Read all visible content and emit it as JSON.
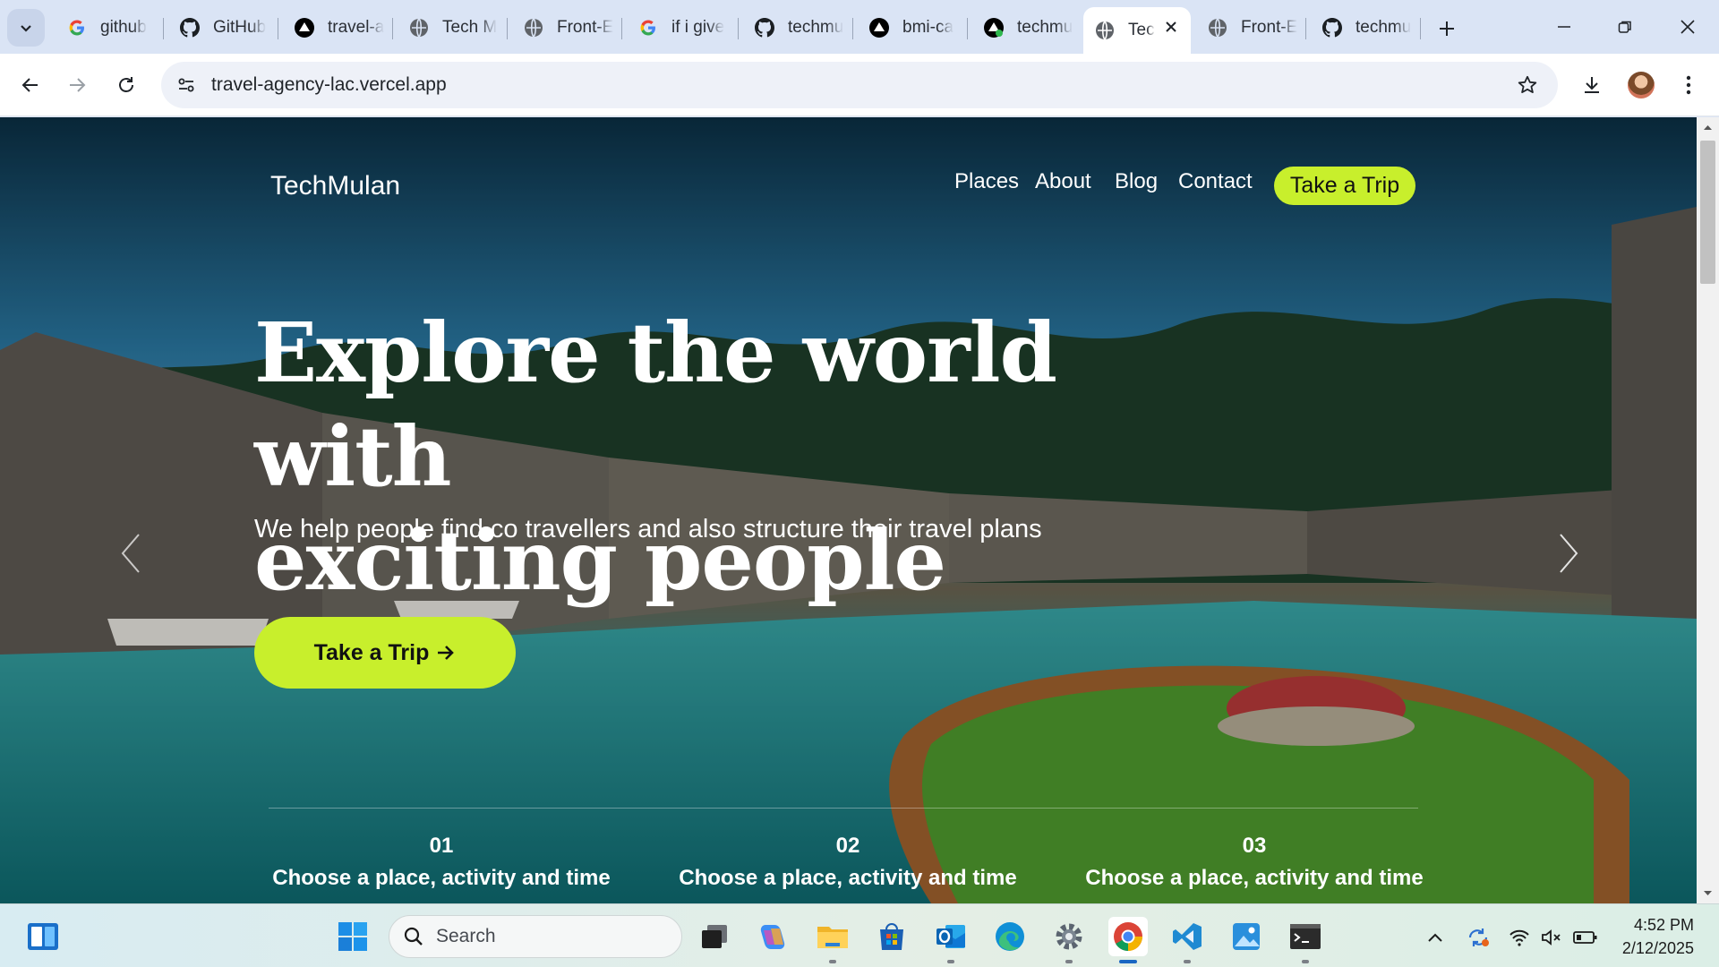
{
  "browser": {
    "tabs": [
      {
        "title": "github",
        "favicon": "google-icon"
      },
      {
        "title": "GitHub",
        "favicon": "github-icon"
      },
      {
        "title": "travel-a",
        "favicon": "vercel-icon"
      },
      {
        "title": "Tech M",
        "favicon": "globe-icon"
      },
      {
        "title": "Front-E",
        "favicon": "globe-icon"
      },
      {
        "title": "if i give",
        "favicon": "google-icon"
      },
      {
        "title": "techmu",
        "favicon": "github-icon"
      },
      {
        "title": "bmi-ca",
        "favicon": "vercel-icon"
      },
      {
        "title": "techmu",
        "favicon": "vercel-icon"
      },
      {
        "title": "Tec",
        "favicon": "globe-icon",
        "active": true
      },
      {
        "title": "Front-E",
        "favicon": "globe-icon"
      },
      {
        "title": "techmu",
        "favicon": "github-icon"
      }
    ],
    "url": "travel-agency-lac.vercel.app"
  },
  "site": {
    "brand": "TechMulan",
    "nav": [
      "Places",
      "About",
      "Blog",
      "Contact"
    ],
    "nav_cta": "Take a Trip",
    "headline_line1": "Explore the world with",
    "headline_line2": "exciting people",
    "subline": "We help people find co travellers and also structure their travel plans",
    "hero_cta": "Take a Trip",
    "steps": [
      {
        "num": "01",
        "text": "Choose a place, activity and time"
      },
      {
        "num": "02",
        "text": "Choose a place, activity and time"
      },
      {
        "num": "03",
        "text": "Choose a place, activity and time"
      }
    ],
    "accent_color": "#c8ef2c"
  },
  "taskbar": {
    "search_placeholder": "Search",
    "time": "4:52 PM",
    "date": "2/12/2025"
  }
}
